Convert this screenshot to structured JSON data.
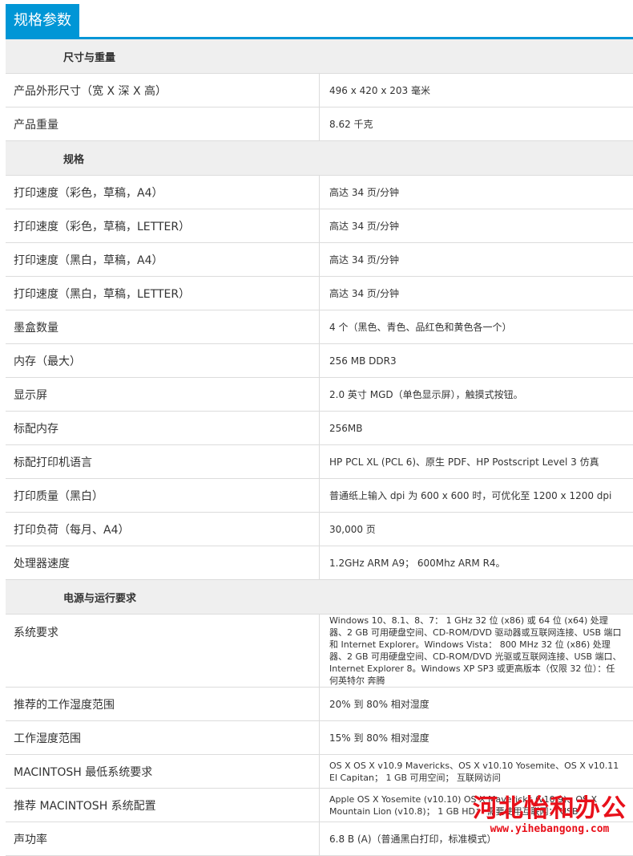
{
  "header": {
    "title": "规格参数"
  },
  "sections": [
    {
      "heading": "尺寸与重量",
      "rows": [
        {
          "label": "产品外形尺寸（宽 X 深 X 高）",
          "value": "496 x 420 x 203 毫米"
        },
        {
          "label": "产品重量",
          "value": "8.62 千克"
        }
      ]
    },
    {
      "heading": "规格",
      "rows": [
        {
          "label": "打印速度（彩色，草稿，A4）",
          "value": "高达 34 页/分钟"
        },
        {
          "label": "打印速度（彩色，草稿，LETTER）",
          "value": "高达 34 页/分钟"
        },
        {
          "label": "打印速度（黑白，草稿，A4）",
          "value": "高达 34 页/分钟"
        },
        {
          "label": "打印速度（黑白，草稿，LETTER）",
          "value": "高达 34 页/分钟"
        },
        {
          "label": "墨盒数量",
          "value": "4 个（黑色、青色、品红色和黄色各一个）"
        },
        {
          "label": "内存（最大）",
          "value": "256 MB DDR3"
        },
        {
          "label": "显示屏",
          "value": "2.0 英寸 MGD（单色显示屏），触摸式按钮。"
        },
        {
          "label": "标配内存",
          "value": "256MB"
        },
        {
          "label": "标配打印机语言",
          "value": "HP PCL XL (PCL 6)、原生 PDF、HP Postscript Level 3 仿真"
        },
        {
          "label": "打印质量（黑白）",
          "value": "普通纸上输入 dpi 为 600 x 600 时，可优化至 1200 x 1200 dpi"
        },
        {
          "label": "打印负荷（每月、A4）",
          "value": "30,000 页"
        },
        {
          "label": "处理器速度",
          "value": "1.2GHz ARM A9； 600Mhz ARM R4。"
        }
      ]
    },
    {
      "heading": "电源与运行要求",
      "rows": [
        {
          "label": "系统要求",
          "value": "Windows 10、8.1、8、7： 1 GHz 32 位 (x86) 或 64 位 (x64) 处理器、2 GB 可用硬盘空间、CD-ROM/DVD 驱动器或互联网连接、USB 端口和 Internet Explorer。Windows Vista： 800 MHz 32 位 (x86) 处理器、2 GB 可用硬盘空间、CD-ROM/DVD 光驱或互联网连接、USB 端口、Internet Explorer 8。Windows XP SP3 或更高版本（仅限 32 位）：任何英特尔 奔腾"
        },
        {
          "label": "推荐的工作湿度范围",
          "value": "20% 到 80% 相对湿度"
        },
        {
          "label": "工作湿度范围",
          "value": "15% 到 80% 相对湿度"
        },
        {
          "label": "MACINTOSH 最低系统要求",
          "value": "OS X OS X v10.9 Mavericks、OS X v10.10 Yosemite、OS X v10.11 El Capitan； 1 GB 可用空间； 互联网访问"
        },
        {
          "label": "推荐 MACINTOSH 系统配置",
          "value": "Apple OS X Yosemite (v10.10) OS X Mavericks (v10.9)、OS X Mountain Lion (v10.8)； 1 GB HD； 需要使用互联网； USB"
        },
        {
          "label": "声功率",
          "value": "6.8 B (A)（普通黑白打印，标准模式）"
        }
      ]
    }
  ],
  "watermark": {
    "brand": "河北怡和办公",
    "url": "www.yihebangong.com"
  }
}
